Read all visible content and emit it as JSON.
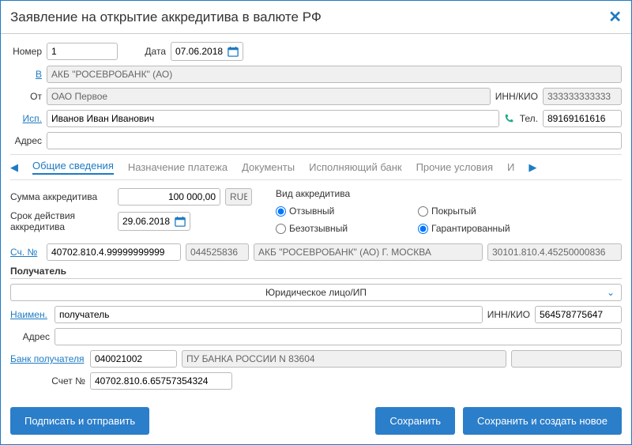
{
  "header": {
    "title": "Заявление на открытие аккредитива в валюте РФ"
  },
  "fields": {
    "number_label": "Номер",
    "number": "1",
    "date_label": "Дата",
    "date": "07.06.2018",
    "bank_label": "В",
    "bank": "АКБ \"РОСЕВРОБАНК\" (АО)",
    "from_label": "От",
    "from": "ОАО Первое",
    "inn_label": "ИНН/КИО",
    "inn": "333333333333",
    "isp_label": "Исп.",
    "isp": "Иванов Иван Иванович",
    "tel_label": "Тел.",
    "tel": "89169161616",
    "address_label": "Адрес"
  },
  "tabs": {
    "t1": "Общие сведения",
    "t2": "Назначение платежа",
    "t3": "Документы",
    "t4": "Исполняющий банк",
    "t5": "Прочие условия",
    "t6": "И"
  },
  "main": {
    "sum_label": "Сумма аккредитива",
    "sum": "100 000,00",
    "currency": "RUB",
    "term_label": "Срок действия аккредитива",
    "term": "29.06.2018",
    "type_header": "Вид аккредитива",
    "r1": "Отзывный",
    "r2": "Безотзывный",
    "r3": "Покрытый",
    "r4": "Гарантированный",
    "acc_label": "Сч. №",
    "acc": "40702.810.4.99999999999",
    "code": "044525836",
    "bank_full": "АКБ \"РОСЕВРОБАНК\" (АО) Г. МОСКВА",
    "corr": "30101.810.4.45250000836"
  },
  "recipient": {
    "header": "Получатель",
    "type": "Юридическое лицо/ИП",
    "name_label": "Наимен.",
    "name": "получатель",
    "inn_label": "ИНН/КИО",
    "inn": "564578775647",
    "address_label": "Адрес",
    "bank_label": "Банк получателя",
    "bank_code": "040021002",
    "bank_name": "ПУ БАНКА РОССИИ N 83604",
    "acc_label": "Счет №",
    "acc": "40702.810.6.65757354324"
  },
  "buttons": {
    "sign": "Подписать и отправить",
    "save": "Сохранить",
    "save_new": "Сохранить и создать новое"
  }
}
